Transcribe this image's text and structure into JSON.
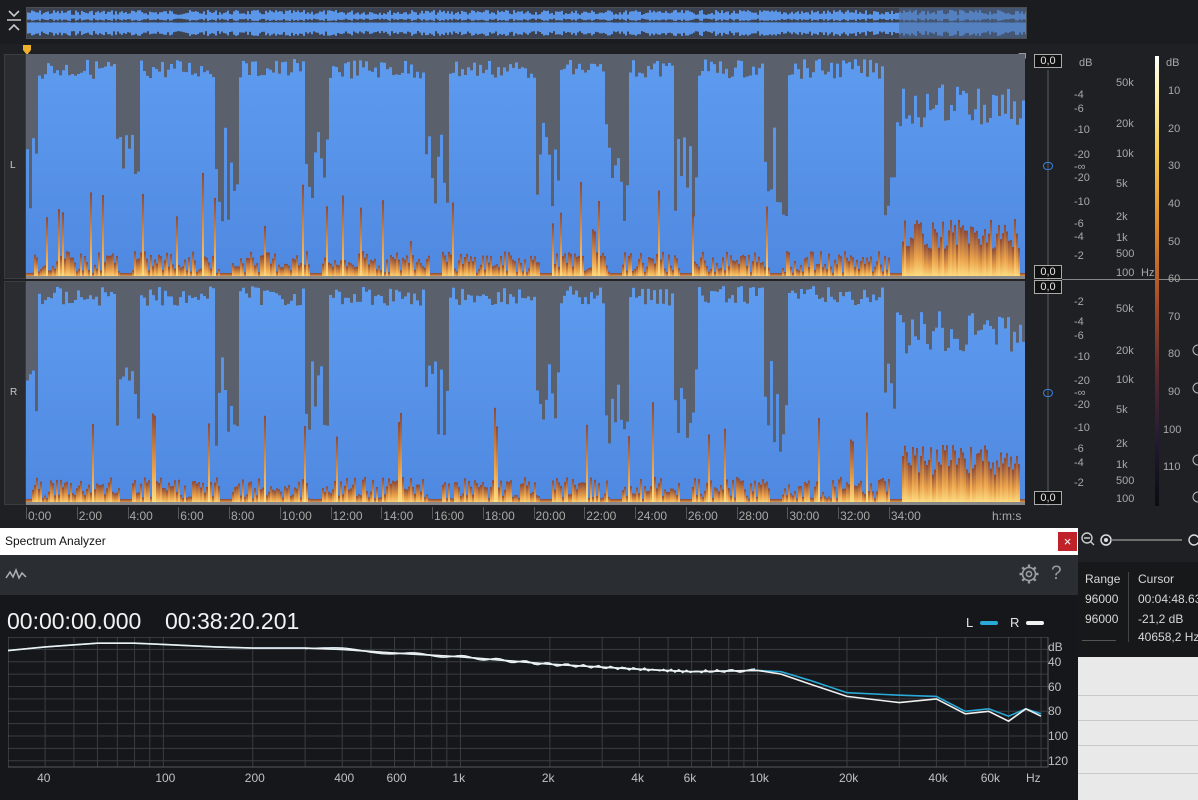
{
  "overview": {
    "collapse_icon": "collapse-vertical-icon"
  },
  "channels": [
    {
      "label": "L",
      "level_top": "0,0",
      "level_bottom": "0,0"
    },
    {
      "label": "R",
      "level_top": "0,0",
      "level_bottom": "0,0"
    }
  ],
  "db_scale": {
    "unit": "dB",
    "L": [
      "-4",
      "-6",
      "-10",
      "-20",
      "-∞",
      "-20",
      "-10",
      "-6",
      "-4",
      "-2"
    ],
    "R": [
      "-2",
      "-4",
      "-6",
      "-10",
      "-20",
      "-∞",
      "-20",
      "-10",
      "-6",
      "-4",
      "-2"
    ]
  },
  "hz_scale": {
    "unit": "Hz",
    "L": [
      "50k",
      "20k",
      "10k",
      "5k",
      "2k",
      "1k",
      "500",
      "100"
    ],
    "R": [
      "50k",
      "20k",
      "10k",
      "5k",
      "2k",
      "1k",
      "500",
      "100"
    ]
  },
  "colorbar": {
    "unit": "dB",
    "labels": [
      "10",
      "20",
      "30",
      "40",
      "50",
      "60",
      "70",
      "80",
      "90",
      "100",
      "110"
    ]
  },
  "time_ruler": {
    "labels": [
      "0:00",
      "2:00",
      "4:00",
      "6:00",
      "8:00",
      "10:00",
      "12:00",
      "14:00",
      "16:00",
      "18:00",
      "20:00",
      "22:00",
      "24:00",
      "26:00",
      "28:00",
      "30:00",
      "32:00",
      "34:00"
    ],
    "unit": "h:m:s"
  },
  "info": {
    "range_header": "Range",
    "cursor_header": "Cursor",
    "range_values": [
      "96000",
      "96000"
    ],
    "cursor_values": [
      "00:04:48.63",
      "-21,2 dB",
      "40658,2 Hz"
    ]
  },
  "spectrum_analyzer": {
    "window_title": "Spectrum Analyzer",
    "close_label": "×",
    "help_label": "?",
    "time_start": "00:00:00.000",
    "time_end": "00:38:20.201",
    "legend": [
      {
        "label": "L",
        "color": "#2aa9d8"
      },
      {
        "label": "R",
        "color": "#f0f0f0"
      }
    ],
    "x_labels": [
      "40",
      "100",
      "200",
      "400",
      "600",
      "1k",
      "2k",
      "4k",
      "6k",
      "10k",
      "20k",
      "40k",
      "60k",
      "Hz"
    ],
    "y_labels": [
      "dB",
      "40",
      "60",
      "80",
      "100",
      "120"
    ]
  },
  "chart_data": {
    "type": "line",
    "x_scale": "log",
    "xlabel": "Hz",
    "ylabel": "dB",
    "x": [
      30,
      40,
      60,
      80,
      100,
      150,
      200,
      300,
      400,
      600,
      1000,
      2000,
      4000,
      6000,
      10000,
      12000,
      15000,
      20000,
      30000,
      40000,
      50000,
      60000,
      70000,
      80000,
      90000
    ],
    "series": [
      {
        "name": "L",
        "values": [
          -31,
          -28,
          -25,
          -25,
          -26,
          -28,
          -29,
          -29,
          -30,
          -33,
          -36,
          -42,
          -46,
          -48,
          -47,
          -48,
          -55,
          -65,
          -67,
          -68,
          -80,
          -78,
          -84,
          -78,
          -82
        ]
      },
      {
        "name": "R",
        "values": [
          -31,
          -28,
          -25,
          -25,
          -26,
          -28,
          -29,
          -29,
          -30,
          -33,
          -36,
          -42,
          -46,
          -48,
          -47,
          -50,
          -58,
          -68,
          -73,
          -70,
          -82,
          -80,
          -88,
          -78,
          -84
        ]
      }
    ],
    "ylim": [
      -125,
      -20
    ]
  }
}
